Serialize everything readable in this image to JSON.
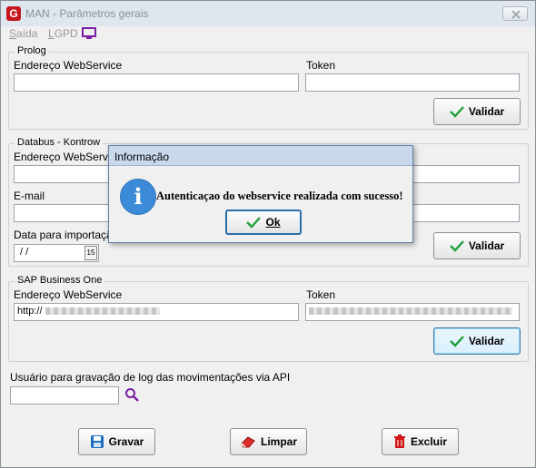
{
  "window": {
    "icon_letter": "G",
    "title": "MAN - Parâmetros gerais"
  },
  "menu": [
    {
      "label": "Saída",
      "underline": "S",
      "rest": "aída"
    },
    {
      "label": "LGPD",
      "underline": "L",
      "rest": "GPD"
    }
  ],
  "prolog": {
    "title": "Prolog",
    "endereco_label": "Endereço WebService",
    "endereco_value": "",
    "token_label": "Token",
    "token_value": "",
    "validar_label": "Validar"
  },
  "databus": {
    "title": "Databus - Kontrow",
    "endereco_label": "Endereço WebService",
    "email_label": "E-mail",
    "data_label": "Data para importação",
    "data_value": "/ /",
    "calendar_icon_text": "15",
    "validar_label": "Validar"
  },
  "sap": {
    "title": "SAP Business One",
    "endereco_label": "Endereço WebService",
    "endereco_value": "http://",
    "token_label": "Token",
    "validar_label": "Validar"
  },
  "usuario_log": {
    "label": "Usuário para gravação de log das movimentações via API",
    "value": ""
  },
  "buttons": {
    "gravar": "Gravar",
    "limpar": "Limpar",
    "excluir": "Excluir"
  },
  "dialog": {
    "title": "Informação",
    "icon": "info-icon",
    "message": "Autenticaçao do webservice realizada com sucesso!",
    "ok_label": "Ok"
  },
  "colors": {
    "check_green": "#1f9e3c",
    "info_blue": "#3b8bd8",
    "purple_icon": "#7a1fa2",
    "delete_red": "#d01616"
  }
}
